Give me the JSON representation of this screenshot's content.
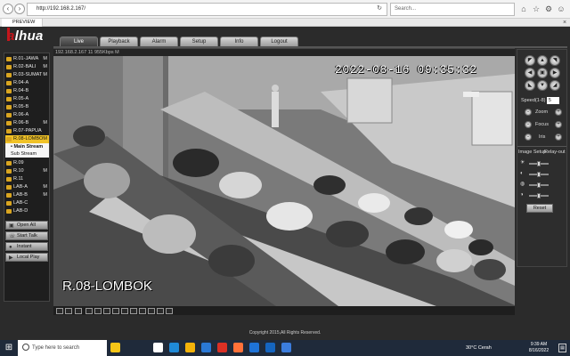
{
  "browser": {
    "url": "http://192.168.2.167/",
    "search_placeholder": "Search...",
    "tab_title": "PREVIEW"
  },
  "app": {
    "logo": "alhua",
    "menu": [
      "Live",
      "Playback",
      "Alarm",
      "Setup",
      "Info",
      "Logout"
    ],
    "active_tab": "Live"
  },
  "channels": [
    {
      "label": "R.01-JAWA",
      "stream": "M"
    },
    {
      "label": "R.02-BALI",
      "stream": "M"
    },
    {
      "label": "R.03-SUMAT",
      "stream": "M"
    },
    {
      "label": "R.04-A",
      "stream": ""
    },
    {
      "label": "R.04-B",
      "stream": ""
    },
    {
      "label": "R.05-A",
      "stream": ""
    },
    {
      "label": "R.05-B",
      "stream": ""
    },
    {
      "label": "R.06-A",
      "stream": ""
    },
    {
      "label": "R.06-B",
      "stream": "M"
    },
    {
      "label": "R.07-PAPUA",
      "stream": ""
    },
    {
      "label": "R.08-LOMBO",
      "stream": "M",
      "selected": true
    }
  ],
  "streams": [
    "• Main Stream",
    "Sub Stream"
  ],
  "channels_after": [
    {
      "label": "R.09",
      "stream": ""
    },
    {
      "label": "R.10",
      "stream": "M"
    },
    {
      "label": "R.11",
      "stream": ""
    },
    {
      "label": "LAB-A",
      "stream": "M"
    },
    {
      "label": "LAB-B",
      "stream": "M"
    },
    {
      "label": "LAB-C",
      "stream": ""
    },
    {
      "label": "LAB-D",
      "stream": ""
    }
  ],
  "side_buttons": [
    "Open All",
    "Start Talk",
    "Instant Record",
    "Local Play"
  ],
  "video": {
    "header": "192.168.2.167 11 955Kbps M",
    "timestamp": "2022-08-16  09:35:32",
    "camera_label": "R.08-LOMBOK"
  },
  "ptz": {
    "speed_label": "Speed(1-8)",
    "speed_value": "5",
    "zoom": "Zoom",
    "focus": "Focus",
    "iris": "Iris",
    "image_setup": "Image Setup",
    "relay_out": "Relay-out",
    "reset": "Reset"
  },
  "copyright": "Copyright 2015,All Rights Reserved.",
  "taskbar": {
    "search_placeholder": "Type here to search",
    "weather": "30°C  Cerah",
    "time": "9:39 AM",
    "date": "8/16/2022"
  }
}
